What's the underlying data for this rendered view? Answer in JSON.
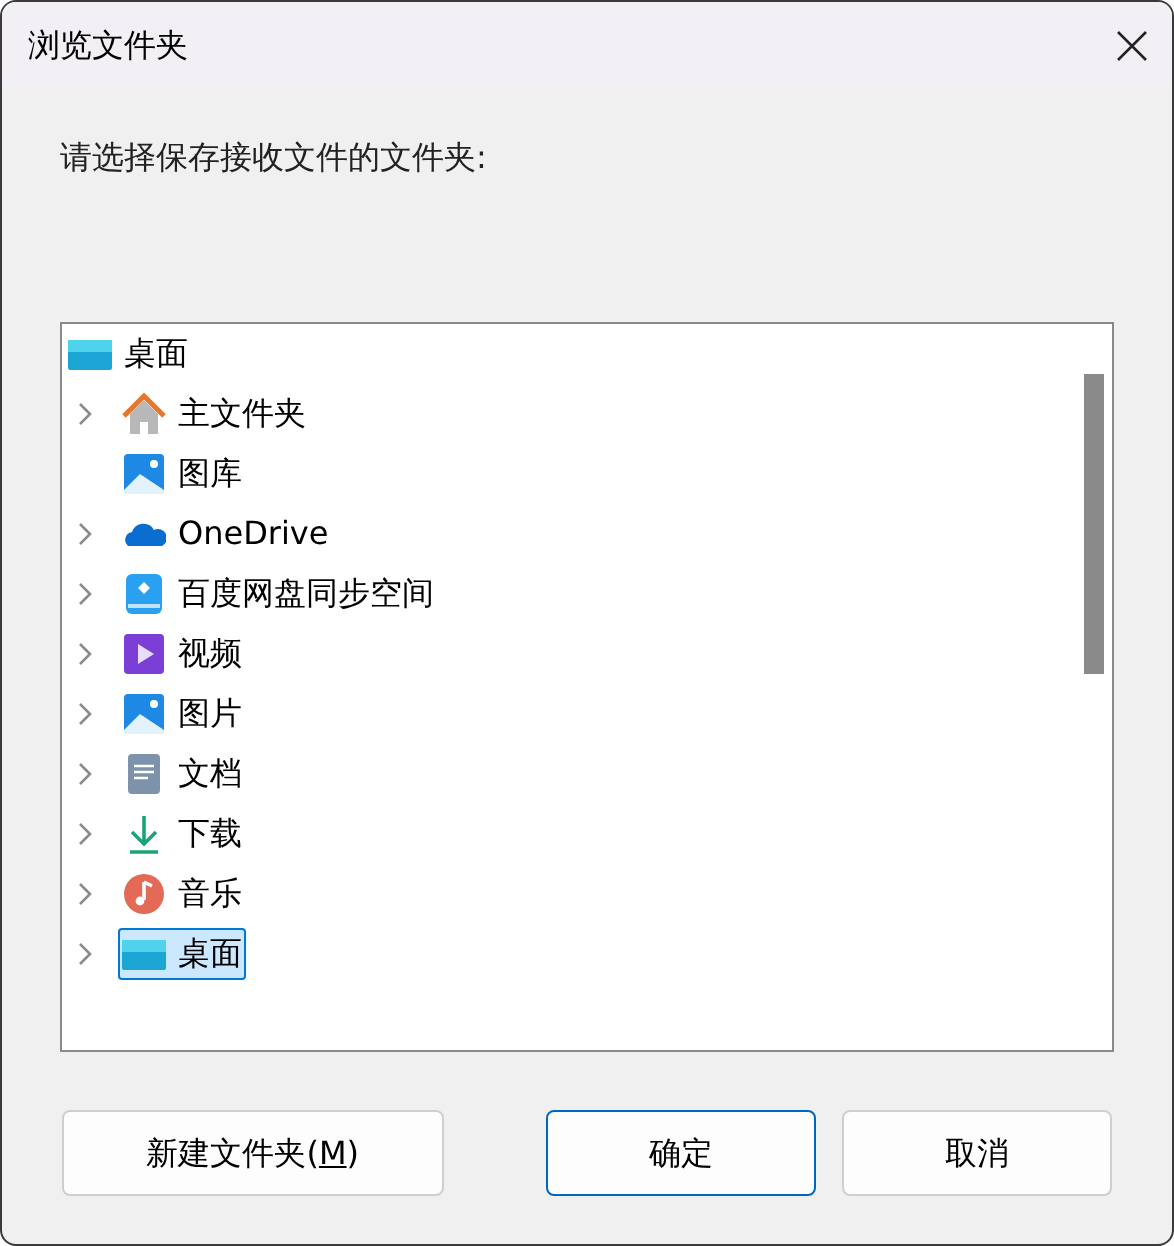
{
  "window": {
    "title": "浏览文件夹"
  },
  "prompt": "请选择保存接收文件的文件夹:",
  "tree": {
    "label": "桌面",
    "kind": "desktop",
    "selected": false,
    "children": [
      {
        "label": "主文件夹",
        "kind": "home",
        "expandable": true,
        "selected": false
      },
      {
        "label": "图库",
        "kind": "gallery",
        "expandable": false,
        "selected": false
      },
      {
        "label": "OneDrive",
        "kind": "cloud",
        "expandable": true,
        "selected": false
      },
      {
        "label": "百度网盘同步空间",
        "kind": "baidu",
        "expandable": true,
        "selected": false
      },
      {
        "label": "视频",
        "kind": "video",
        "expandable": true,
        "selected": false
      },
      {
        "label": "图片",
        "kind": "pictures",
        "expandable": true,
        "selected": false
      },
      {
        "label": "文档",
        "kind": "documents",
        "expandable": true,
        "selected": false
      },
      {
        "label": "下载",
        "kind": "download",
        "expandable": true,
        "selected": false
      },
      {
        "label": "音乐",
        "kind": "music",
        "expandable": true,
        "selected": false
      },
      {
        "label": "桌面",
        "kind": "desktop",
        "expandable": true,
        "selected": true
      }
    ]
  },
  "buttons": [
    {
      "label_before": "新建文件夹(",
      "mnemonic": "M",
      "label_after": ")",
      "kind": "new-folder",
      "default": false
    },
    {
      "label": "确定",
      "kind": "ok",
      "default": true
    },
    {
      "label": "取消",
      "kind": "cancel",
      "default": false
    }
  ]
}
